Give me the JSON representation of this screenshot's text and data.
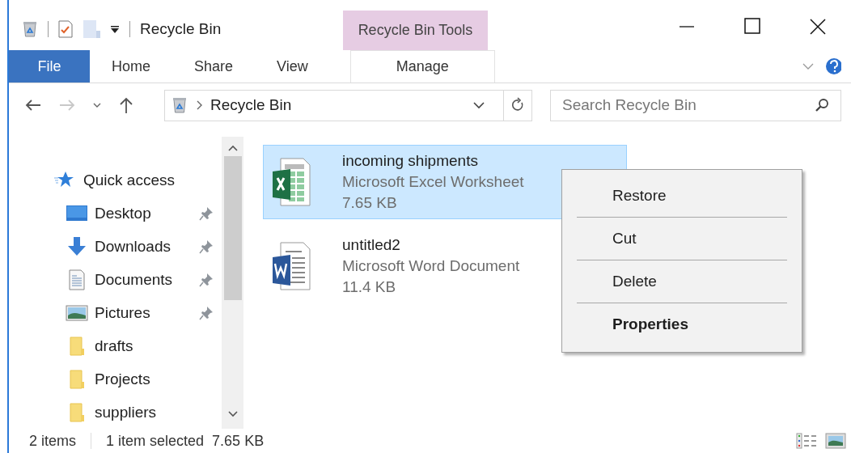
{
  "title_bar": {
    "title": "Recycle Bin",
    "contextual_group": "Recycle Bin Tools"
  },
  "ribbon_tabs": [
    {
      "label": "File",
      "kind": "file"
    },
    {
      "label": "Home",
      "kind": "tab"
    },
    {
      "label": "Share",
      "kind": "tab"
    },
    {
      "label": "View",
      "kind": "tab"
    },
    {
      "label": "Manage",
      "kind": "contextual"
    }
  ],
  "navigation": {
    "back_disabled": false,
    "forward_disabled": true
  },
  "address_bar": {
    "path": "Recycle Bin"
  },
  "search": {
    "placeholder": "Search Recycle Bin"
  },
  "sidebar": {
    "items": [
      {
        "label": "Quick access",
        "kind": "star",
        "children": [
          {
            "label": "Desktop",
            "kind": "desktop",
            "pinned": true
          },
          {
            "label": "Downloads",
            "kind": "download",
            "pinned": true
          },
          {
            "label": "Documents",
            "kind": "documents",
            "pinned": true
          },
          {
            "label": "Pictures",
            "kind": "pictures",
            "pinned": true
          },
          {
            "label": "drafts",
            "kind": "folder",
            "pinned": false
          },
          {
            "label": "Projects",
            "kind": "folder",
            "pinned": false
          },
          {
            "label": "suppliers",
            "kind": "folder",
            "pinned": false
          }
        ]
      }
    ]
  },
  "files": [
    {
      "name": "incoming shipments",
      "type": "Microsoft Excel Worksheet",
      "size": "7.65 KB",
      "kind": "spreadsheet",
      "selected": true
    },
    {
      "name": "untitled2",
      "type": "Microsoft Word Document",
      "size": "11.4 KB",
      "kind": "document",
      "selected": false
    }
  ],
  "context_menu": {
    "items": [
      {
        "label": "Restore",
        "default": false
      },
      {
        "label": "Cut",
        "default": false
      },
      {
        "label": "Delete",
        "default": false
      },
      {
        "label": "Properties",
        "default": true
      }
    ]
  },
  "status_bar": {
    "item_count": "2 items",
    "selection": "1 item selected",
    "selection_size": "7.65 KB"
  }
}
